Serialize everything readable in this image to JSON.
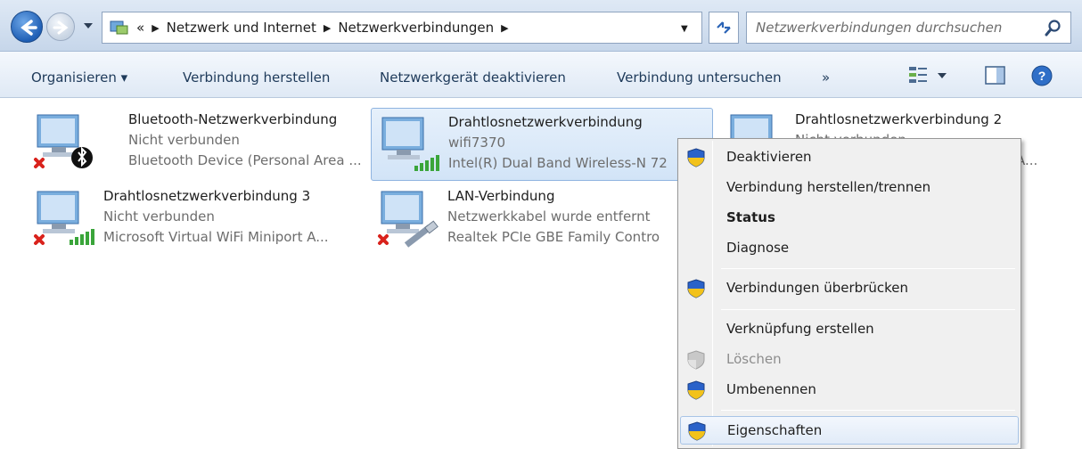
{
  "address": {
    "overflow": "«",
    "crumbs": [
      "Netzwerk und Internet",
      "Netzwerkverbindungen"
    ],
    "search_placeholder": "Netzwerkverbindungen durchsuchen"
  },
  "toolbar": {
    "organize": "Organisieren ▾",
    "connect": "Verbindung herstellen",
    "disable": "Netzwerkgerät deaktivieren",
    "diagnose": "Verbindung untersuchen",
    "more": "»"
  },
  "connections": [
    {
      "name": "Bluetooth-Netzwerkverbindung",
      "status": "Nicht verbunden",
      "device": "Bluetooth Device (Personal Area ...",
      "icon": "bluetooth-adapter-icon"
    },
    {
      "name": "Drahtlosnetzwerkverbindung",
      "status": "wifi7370",
      "device": "Intel(R) Dual Band Wireless-N 72",
      "icon": "wireless-adapter-icon"
    },
    {
      "name": "Drahtlosnetzwerkverbindung 2",
      "status": "Nicht verbunden",
      "device": "A...",
      "icon": "wireless-adapter-icon"
    },
    {
      "name": "Drahtlosnetzwerkverbindung 3",
      "status": "Nicht verbunden",
      "device": "Microsoft Virtual WiFi Miniport A...",
      "icon": "wireless-adapter-icon"
    },
    {
      "name": "LAN-Verbindung",
      "status": "Netzwerkkabel wurde entfernt",
      "device": "Realtek PCIe GBE Family Contro",
      "icon": "ethernet-adapter-icon"
    }
  ],
  "context_menu": {
    "items": [
      {
        "label": "Deaktivieren",
        "shield": true
      },
      {
        "label": "Verbindung herstellen/trennen",
        "shield": false
      },
      {
        "label": "Status",
        "shield": false,
        "bold": true
      },
      {
        "label": "Diagnose",
        "shield": false
      },
      {
        "label": "Verbindungen überbrücken",
        "shield": true
      },
      {
        "label": "Verknüpfung erstellen",
        "shield": false
      },
      {
        "label": "Löschen",
        "shield": true,
        "disabled": true
      },
      {
        "label": "Umbenennen",
        "shield": true
      },
      {
        "label": "Eigenschaften",
        "shield": true,
        "highlighted": true
      }
    ]
  },
  "colors": {
    "accent": "#2b64b6",
    "selection": "#d2e4f7",
    "error": "#d9221c",
    "signal": "#3aa53a"
  }
}
